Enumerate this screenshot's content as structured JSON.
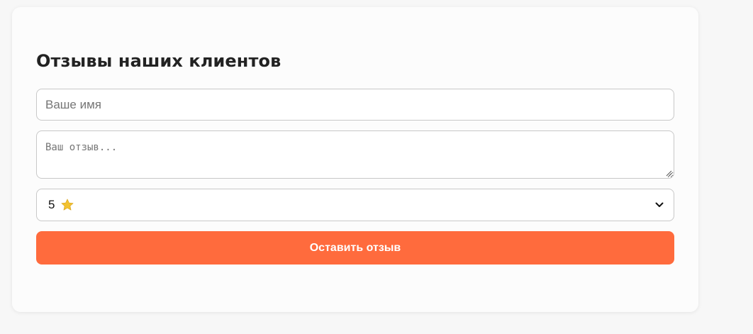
{
  "review_form": {
    "title": "Отзывы наших клиентов",
    "name_field": {
      "placeholder": "Ваше имя",
      "value": ""
    },
    "review_field": {
      "placeholder": "Ваш отзыв...",
      "value": ""
    },
    "rating_select": {
      "selected_value": "5",
      "icon": "star-icon"
    },
    "submit_label": "Оставить отзыв"
  },
  "colors": {
    "accent": "#ff6b3d",
    "card_background": "#fcfcfc",
    "page_background": "#f7f7f7",
    "field_border": "#c8c8c8",
    "star": "#f2c230"
  }
}
